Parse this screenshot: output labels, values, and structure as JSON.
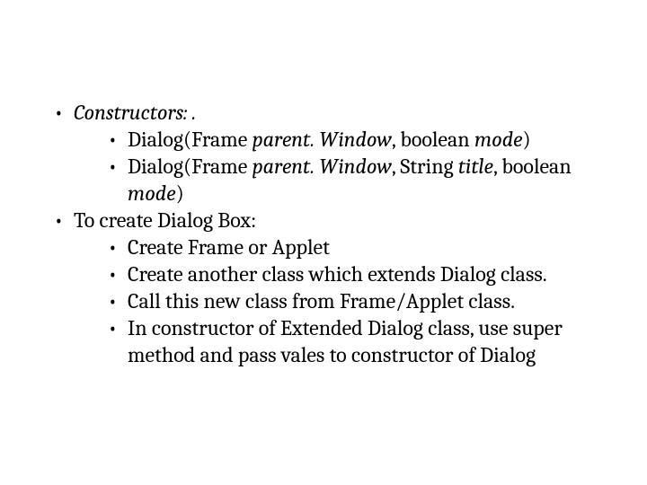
{
  "slide": {
    "outer": [
      {
        "label_italic": "Constructors: .",
        "children": [
          {
            "parts": [
              {
                "t": "Dialog(Frame ",
                "i": false
              },
              {
                "t": "parent. Window",
                "i": true
              },
              {
                "t": ", boolean ",
                "i": false
              },
              {
                "t": "mode",
                "i": true
              },
              {
                "t": ")",
                "i": false
              }
            ]
          },
          {
            "parts": [
              {
                "t": "Dialog(Frame ",
                "i": false
              },
              {
                "t": "parent. Window",
                "i": true
              },
              {
                "t": ", String ",
                "i": false
              },
              {
                "t": "title",
                "i": true
              },
              {
                "t": ", boolean ",
                "i": false
              },
              {
                "t": "mode",
                "i": true
              },
              {
                "t": ")",
                "i": false
              }
            ]
          }
        ]
      },
      {
        "label": "To create Dialog Box:",
        "children": [
          {
            "parts": [
              {
                "t": "Create Frame or Applet",
                "i": false
              }
            ]
          },
          {
            "parts": [
              {
                "t": "Create another class which extends Dialog class.",
                "i": false
              }
            ]
          },
          {
            "parts": [
              {
                "t": "Call this new class from Frame/Applet class.",
                "i": false
              }
            ]
          },
          {
            "parts": [
              {
                "t": "In constructor of Extended Dialog class, use super method and pass vales to constructor of Dialog",
                "i": false
              }
            ]
          }
        ]
      }
    ]
  }
}
